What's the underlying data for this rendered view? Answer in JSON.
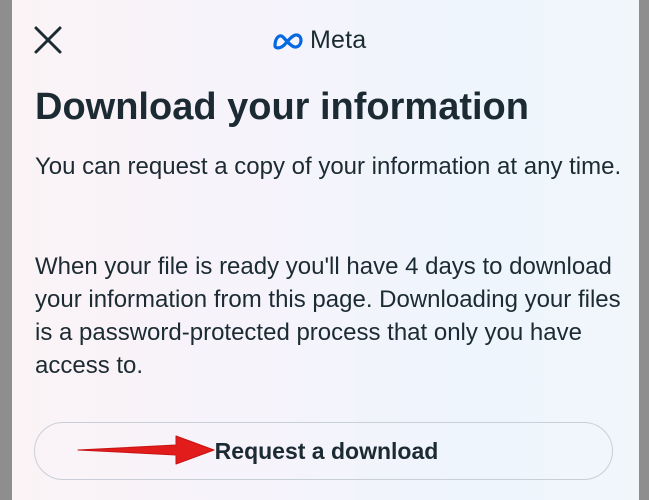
{
  "header": {
    "close_icon": "close-icon",
    "logo_icon": "meta-infinity-logo",
    "logo_text": "Meta"
  },
  "main": {
    "title": "Download your information",
    "paragraph_1": "You can request a copy of your information at any time.",
    "paragraph_2": "When your file is ready you'll have 4 days to download your information from this page. Downloading your files is a password-protected process that only you have access to.",
    "download_button_label": "Request a download"
  },
  "annotation": {
    "arrow_icon": "red-arrow-icon",
    "arrow_color": "#e21b1b"
  },
  "colors": {
    "text": "#1c2b33",
    "meta_blue": "#0668e1",
    "button_border": "#c9cfd6"
  }
}
